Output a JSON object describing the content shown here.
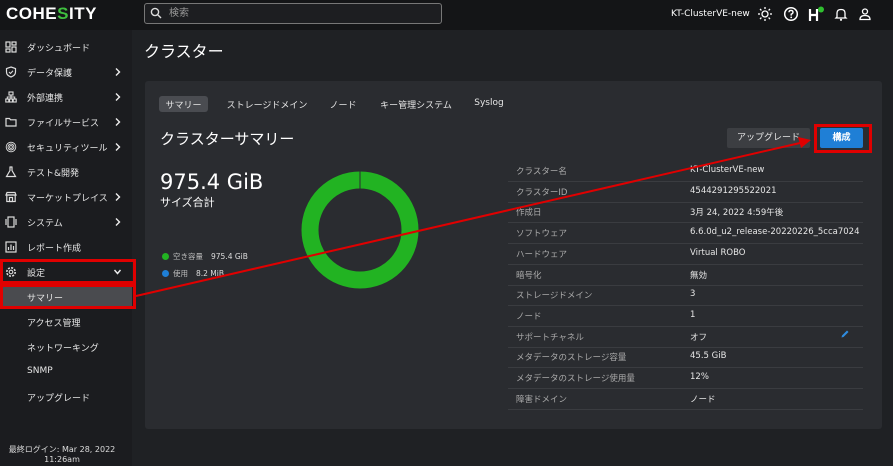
{
  "topbar": {
    "logo_text": "COHE",
    "logo_accent": "S",
    "logo_rest": "ITY",
    "search_placeholder": "検索",
    "cluster_name": "KT-ClusterVE-new",
    "icons": [
      "search-icon",
      "sun-icon",
      "help-icon",
      "health-icon",
      "bell-icon",
      "user-icon"
    ]
  },
  "sidebar": {
    "items": [
      {
        "label": "ダッシュボード",
        "icon": "dashboard-icon",
        "chevron": false
      },
      {
        "label": "データ保護",
        "icon": "shield-icon",
        "chevron": true
      },
      {
        "label": "外部連携",
        "icon": "network-icon",
        "chevron": true
      },
      {
        "label": "ファイルサービス",
        "icon": "folder-icon",
        "chevron": true
      },
      {
        "label": "セキュリティツール",
        "icon": "fingerprint-icon",
        "chevron": true
      },
      {
        "label": "テスト&開発",
        "icon": "flask-icon",
        "chevron": false
      },
      {
        "label": "マーケットプレイス",
        "icon": "store-icon",
        "chevron": true
      },
      {
        "label": "システム",
        "icon": "system-icon",
        "chevron": true
      },
      {
        "label": "レポート作成",
        "icon": "report-icon",
        "chevron": false
      },
      {
        "label": "設定",
        "icon": "gear-icon",
        "chevron": true
      }
    ],
    "sub_items": [
      "サマリー",
      "アクセス管理",
      "ネットワーキング",
      "SNMP",
      "アップグレード"
    ],
    "last_login": "最終ログイン: Mar 28, 2022",
    "last_login_time": "11:26am"
  },
  "page": {
    "title": "クラスター"
  },
  "tabs": [
    "サマリー",
    "ストレージドメイン",
    "ノード",
    "キー管理システム",
    "Syslog"
  ],
  "summary": {
    "title": "クラスターサマリー",
    "upgrade_label": "アップグレード",
    "config_label": "構成",
    "total_size": "975.4 GiB",
    "total_size_label": "サイズ合計",
    "legend": [
      {
        "label": "空き容量",
        "value": "975.4 GiB",
        "color": "#22b322"
      },
      {
        "label": "使用",
        "value": "8.2 MiB",
        "color": "#1f7fd6"
      }
    ],
    "details": [
      {
        "label": "クラスター名",
        "value": "KT-ClusterVE-new"
      },
      {
        "label": "クラスターID",
        "value": "4544291295522021"
      },
      {
        "label": "作成日",
        "value": "3月 24, 2022 4:59午後"
      },
      {
        "label": "ソフトウェア",
        "value": "6.6.0d_u2_release-20220226_5cca7024"
      },
      {
        "label": "ハードウェア",
        "value": "Virtual ROBO"
      },
      {
        "label": "暗号化",
        "value": "無効"
      },
      {
        "label": "ストレージドメイン",
        "value": "3"
      },
      {
        "label": "ノード",
        "value": "1"
      },
      {
        "label": "サポートチャネル",
        "value": "オフ"
      },
      {
        "label": "メタデータのストレージ容量",
        "value": "45.5 GiB"
      },
      {
        "label": "メタデータのストレージ使用量",
        "value": "12%"
      },
      {
        "label": "障害ドメイン",
        "value": "ノード"
      }
    ]
  },
  "colors": {
    "accent": "#1f7fd6",
    "free": "#22b322",
    "highlight": "#e00000"
  }
}
